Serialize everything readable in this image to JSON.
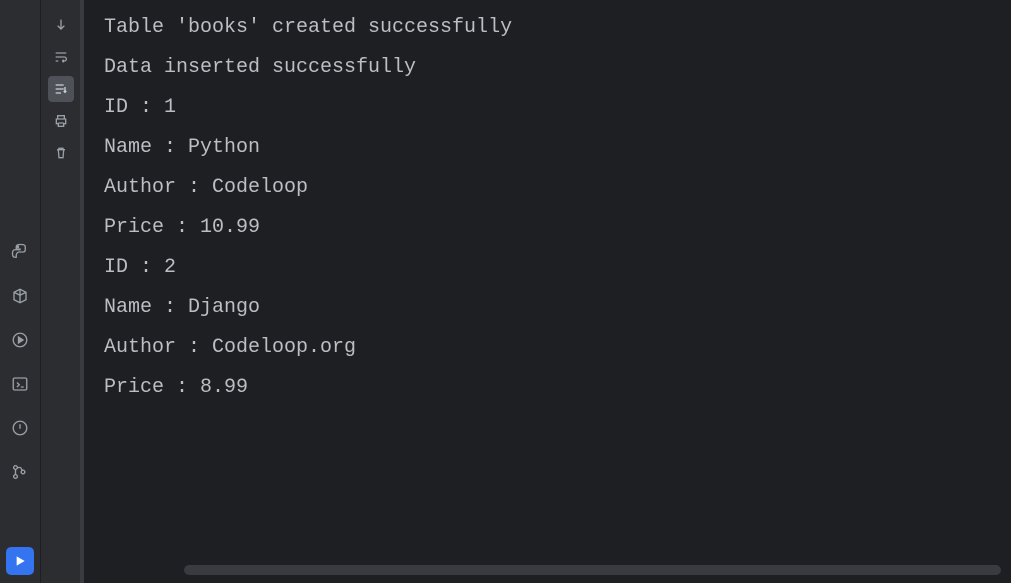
{
  "output": {
    "lines": [
      "Table 'books' created successfully",
      "Data inserted successfully",
      "ID : 1",
      "Name : Python",
      "Author : Codeloop",
      "Price : 10.99",
      "",
      "ID : 2",
      "Name : Django",
      "Author : Codeloop.org",
      "Price : 8.99"
    ]
  },
  "icons": {
    "python": "python-icon",
    "packages": "packages-icon",
    "services": "services-icon",
    "terminal": "terminal-icon",
    "problems": "problems-icon",
    "git": "git-icon",
    "run": "run-icon",
    "down": "down-arrow-icon",
    "wrap": "soft-wrap-icon",
    "scroll": "scroll-to-end-icon",
    "print": "print-icon",
    "trash": "trash-icon"
  }
}
